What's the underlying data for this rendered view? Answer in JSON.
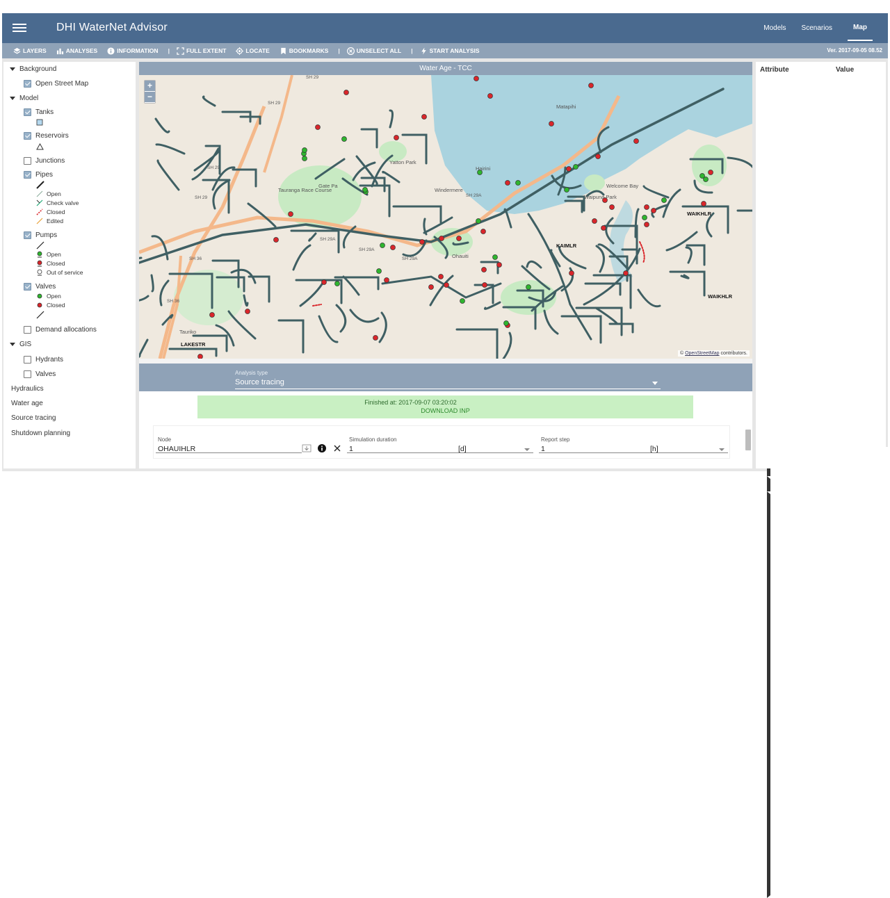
{
  "app": {
    "title": "DHI WaterNet Advisor",
    "version": "Ver. 2017-09-05 08.52"
  },
  "nav": {
    "models": "Models",
    "scenarios": "Scenarios",
    "map": "Map",
    "active": "Map"
  },
  "toolbar": {
    "layers": "LAYERS",
    "analyses": "ANALYSES",
    "information": "INFORMATION",
    "full_extent": "FULL EXTENT",
    "locate": "LOCATE",
    "bookmarks": "BOOKMARKS",
    "unselect_all": "UNSELECT ALL",
    "start_analysis": "START ANALYSIS",
    "separator": "|"
  },
  "layers": {
    "background": "Background",
    "osm": "Open Street Map",
    "model": "Model",
    "tanks": "Tanks",
    "reservoirs": "Reservoirs",
    "junctions": "Junctions",
    "pipes": "Pipes",
    "pipe_legend": [
      "Open",
      "Check valve",
      "Closed",
      "Edited"
    ],
    "pumps": "Pumps",
    "pump_legend": [
      "Open",
      "Closed",
      "Out of service"
    ],
    "valves": "Valves",
    "valve_legend": [
      "Open",
      "Closed"
    ],
    "demand_allocations": "Demand allocations",
    "gis": "GIS",
    "hydrants": "Hydrants",
    "gis_valves": "Valves",
    "hydraulics": "Hydraulics",
    "water_age": "Water age",
    "source_tracing": "Source tracing",
    "shutdown_planning": "Shutdown planning"
  },
  "map": {
    "title": "Water Age - TCC",
    "zoom_in": "+",
    "zoom_out": "−",
    "attribution_prefix": "©",
    "attribution_link": "OpenStreetMap",
    "attribution_suffix": "contributors.",
    "labels": [
      "SH 29",
      "SH 29",
      "SH 29",
      "SH 29",
      "SH 29A",
      "SH 29A",
      "SH 29A",
      "SH 29A",
      "SH 36",
      "SH 36",
      "KAIMLR",
      "WAIKHLR",
      "WAIKHLR",
      "LAKESTR",
      "Hairini",
      "Ohauiti",
      "Welcome Bay",
      "Matapihi",
      "Yatton Park",
      "Waipuna Park",
      "Tauranga Race Course",
      "Gate Pa",
      "Windermere",
      "Tauriko"
    ],
    "colors": {
      "pipe": "#3f5f63",
      "water": "#aad3df",
      "park": "#c8eac3",
      "highway": "#f4b88a",
      "closed": "#d9262b",
      "open": "#2fb52f"
    }
  },
  "analysis": {
    "type_label": "Analysis type",
    "type_value": "Source tracing",
    "finished": "Finished at: 2017-09-07 03:20:02",
    "download": "DOWNLOAD INP",
    "node_label": "Node",
    "node_value": "OHAUIHLR",
    "sim_label": "Simulation duration",
    "sim_value": "1",
    "sim_unit": "[d]",
    "report_label": "Report step",
    "report_value": "1",
    "report_unit": "[h]"
  },
  "attributes": {
    "attribute": "Attribute",
    "value": "Value"
  }
}
